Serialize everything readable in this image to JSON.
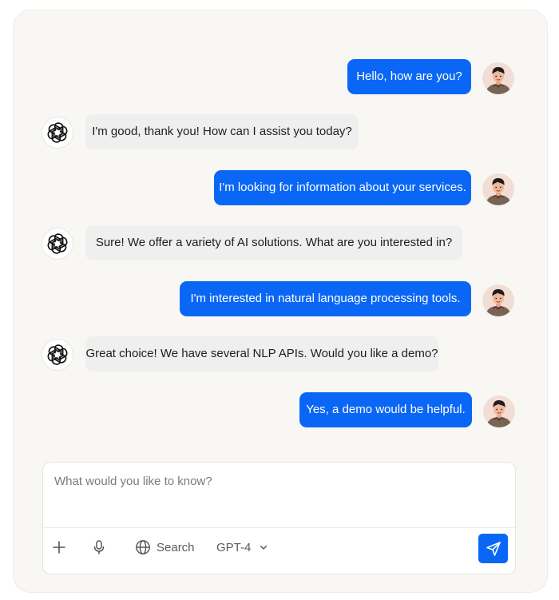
{
  "messages": [
    {
      "role": "user",
      "text": "Hello, how are you?"
    },
    {
      "role": "assistant",
      "text": "I'm good, thank you! How can I assist you today?"
    },
    {
      "role": "user",
      "text": "I'm looking for information about your services."
    },
    {
      "role": "assistant",
      "text": "Sure! We offer a variety of AI solutions. What are you interested in?"
    },
    {
      "role": "user",
      "text": "I'm interested in natural language processing tools."
    },
    {
      "role": "assistant",
      "text": "Great choice! We have several NLP APIs. Would you like a demo?"
    },
    {
      "role": "user",
      "text": "Yes, a demo would be helpful."
    }
  ],
  "composer": {
    "placeholder": "What would you like to know?",
    "search_label": "Search",
    "model_label": "GPT-4"
  },
  "colors": {
    "user_bubble": "#0a67f5",
    "assistant_bubble": "#efefef",
    "send_button": "#0a67f5",
    "panel_background": "#f8f7f4"
  },
  "icons": {
    "assistant_avatar": "openai-logo-icon",
    "user_avatar": "user-avatar",
    "attach": "plus-icon",
    "voice": "microphone-icon",
    "search": "globe-icon",
    "model_dropdown": "chevron-down-icon",
    "send": "send-icon"
  }
}
